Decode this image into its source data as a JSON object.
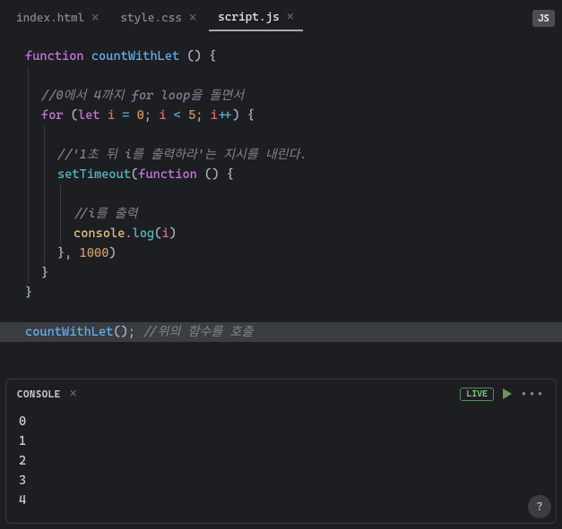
{
  "tabs": [
    {
      "label": "index.html",
      "active": false
    },
    {
      "label": "style.css",
      "active": false
    },
    {
      "label": "script.js",
      "active": true
    }
  ],
  "lang_badge": "JS",
  "code": {
    "l1_kw": "function",
    "l1_fn": "countWithLet",
    "l1_rest": " () {",
    "l2": "",
    "l3_comment": "//0에서 4까지 for loop을 돌면서",
    "l4_for": "for",
    "l4_let": "let",
    "l4_i1": "i",
    "l4_eq": "=",
    "l4_zero": "0",
    "l4_semi1": ";",
    "l4_i2": "i",
    "l4_lt": "<",
    "l4_five": "5",
    "l4_semi2": ";",
    "l4_i3": "i",
    "l4_pp": "++",
    "l4_end": ") {",
    "l5": "",
    "l6_comment": "//'1초 뒤 i를 출력하라'는 지시를 내린다.",
    "l7_st": "setTimeout",
    "l7_p1": "(",
    "l7_fn": "function",
    "l7_rest": " () {",
    "l8": "",
    "l9_comment": "//i를 출력",
    "l10_console": "console",
    "l10_dot": ".",
    "l10_log": "log",
    "l10_p1": "(",
    "l10_i": "i",
    "l10_p2": ")",
    "l11_close": "}, ",
    "l11_num": "1000",
    "l11_p": ")",
    "l12": "}",
    "l13": "}",
    "l14_call": "countWithLet",
    "l14_paren": "();",
    "l14_comment": " //위의 함수를 호출"
  },
  "console": {
    "title": "CONSOLE",
    "live": "LIVE",
    "output": [
      "0",
      "1",
      "2",
      "3",
      "4"
    ]
  },
  "help": "?"
}
